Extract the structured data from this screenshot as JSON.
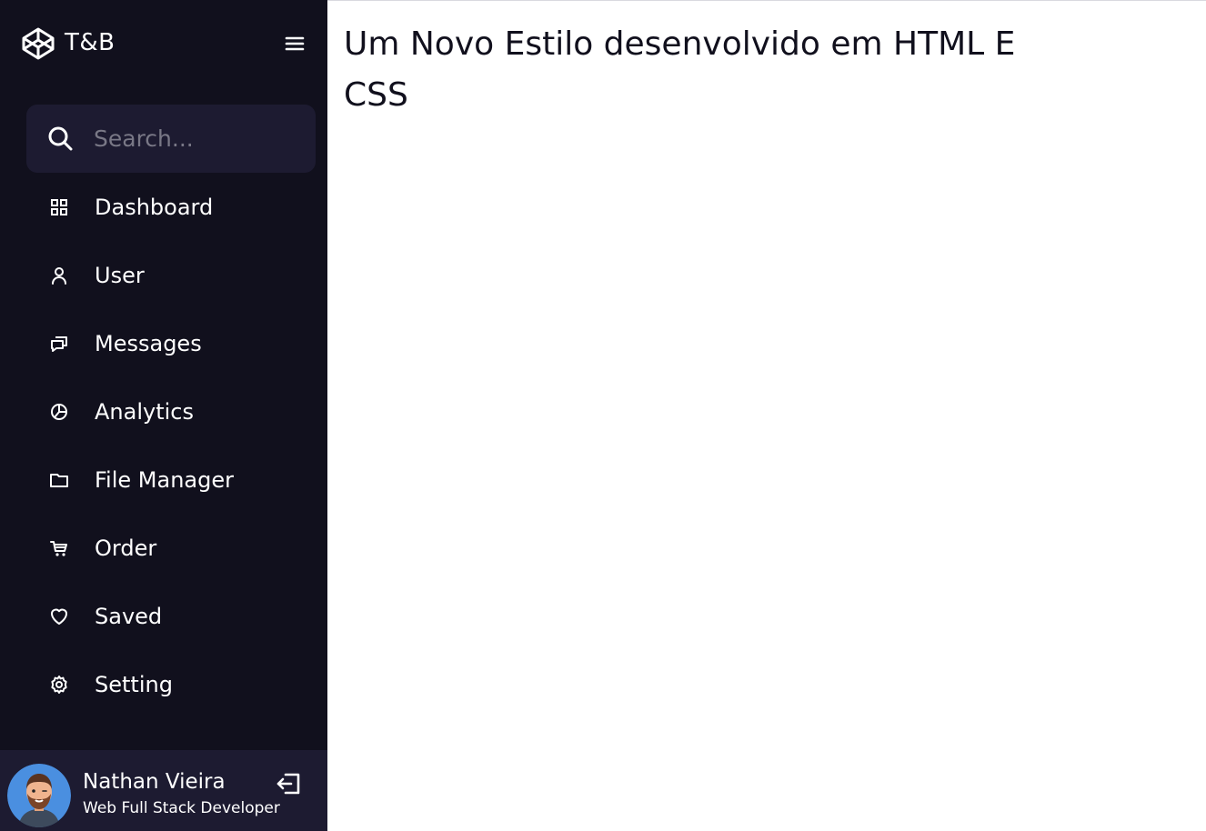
{
  "brand": {
    "name": "T&B",
    "logo_icon": "codepen-cube-icon"
  },
  "header": {
    "menu_icon": "hamburger-icon"
  },
  "search": {
    "placeholder": "Search...",
    "value": "",
    "icon": "search-icon"
  },
  "sidebar": {
    "items": [
      {
        "label": "Dashboard",
        "icon": "grid-icon"
      },
      {
        "label": "User",
        "icon": "user-icon"
      },
      {
        "label": "Messages",
        "icon": "chat-icon"
      },
      {
        "label": "Analytics",
        "icon": "pie-chart-icon"
      },
      {
        "label": "File Manager",
        "icon": "folder-icon"
      },
      {
        "label": "Order",
        "icon": "cart-icon"
      },
      {
        "label": "Saved",
        "icon": "heart-icon"
      },
      {
        "label": "Setting",
        "icon": "cog-icon"
      }
    ]
  },
  "profile": {
    "name": "Nathan Vieira",
    "job": "Web Full Stack Developer",
    "logout_icon": "logout-icon"
  },
  "main": {
    "title": "Um Novo Estilo desenvolvido em HTML E CSS"
  },
  "colors": {
    "sidebar_bg": "#11101d",
    "panel_bg": "#1d1b31",
    "text": "#ffffff",
    "placeholder": "#797886",
    "content_text": "#11101d"
  }
}
